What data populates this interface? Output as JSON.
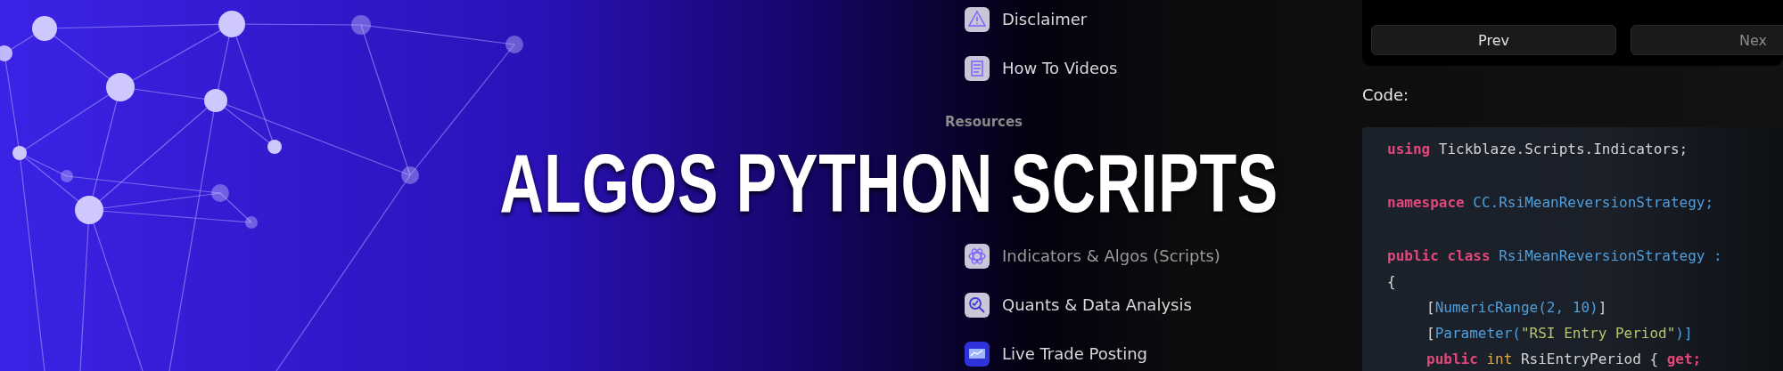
{
  "banner": {
    "title": "ALGOS PYTHON SCRIPTS"
  },
  "sidebar": {
    "items": [
      {
        "label": "Disclaimer"
      },
      {
        "label": "How To Videos"
      },
      {
        "kind": "heading",
        "label": "Resources"
      },
      {
        "kind": "covered"
      },
      {
        "kind": "covered"
      },
      {
        "label": "Indicators & Algos (Scripts)"
      },
      {
        "label": "Quants & Data Analysis"
      },
      {
        "label": "Live Trade Posting"
      }
    ]
  },
  "pager": {
    "buttons": [
      {
        "label": "Prev"
      },
      {
        "label": "Nex"
      }
    ]
  },
  "code_section": {
    "label": "Code:",
    "lines": [
      {
        "tokens": [
          {
            "text": "using",
            "kind": "keyword"
          },
          {
            "text": " Tickblaze.Scripts.Indicators;",
            "kind": "plain"
          }
        ]
      },
      {
        "kind": "blank"
      },
      {
        "tokens": [
          {
            "text": "namespace",
            "kind": "keyword"
          },
          {
            "text": " CC.RsiMeanReversionStrategy;",
            "kind": "type"
          }
        ]
      },
      {
        "kind": "blank"
      },
      {
        "tokens": [
          {
            "text": "public class",
            "kind": "keyword"
          },
          {
            "text": " RsiMeanReversionStrategy : ",
            "kind": "type"
          }
        ]
      },
      {
        "tokens": [
          {
            "text": "{",
            "kind": "plain"
          }
        ]
      },
      {
        "indent": true,
        "tokens": [
          {
            "text": "[",
            "kind": "plain"
          },
          {
            "text": "NumericRange(2, 10)",
            "kind": "type"
          },
          {
            "text": "]",
            "kind": "plain"
          }
        ]
      },
      {
        "indent": true,
        "tokens": [
          {
            "text": "[",
            "kind": "plain"
          },
          {
            "text": "Parameter(",
            "kind": "type"
          },
          {
            "text": "\"RSI Entry Period\"",
            "kind": "string"
          },
          {
            "text": ")]",
            "kind": "type"
          }
        ]
      },
      {
        "indent": true,
        "tokens": [
          {
            "text": "public",
            "kind": "keyword"
          },
          {
            "text": " int",
            "kind": "number"
          },
          {
            "text": " RsiEntryPeriod { ",
            "kind": "plain"
          },
          {
            "text": "get;",
            "kind": "keyword"
          }
        ]
      }
    ]
  }
}
